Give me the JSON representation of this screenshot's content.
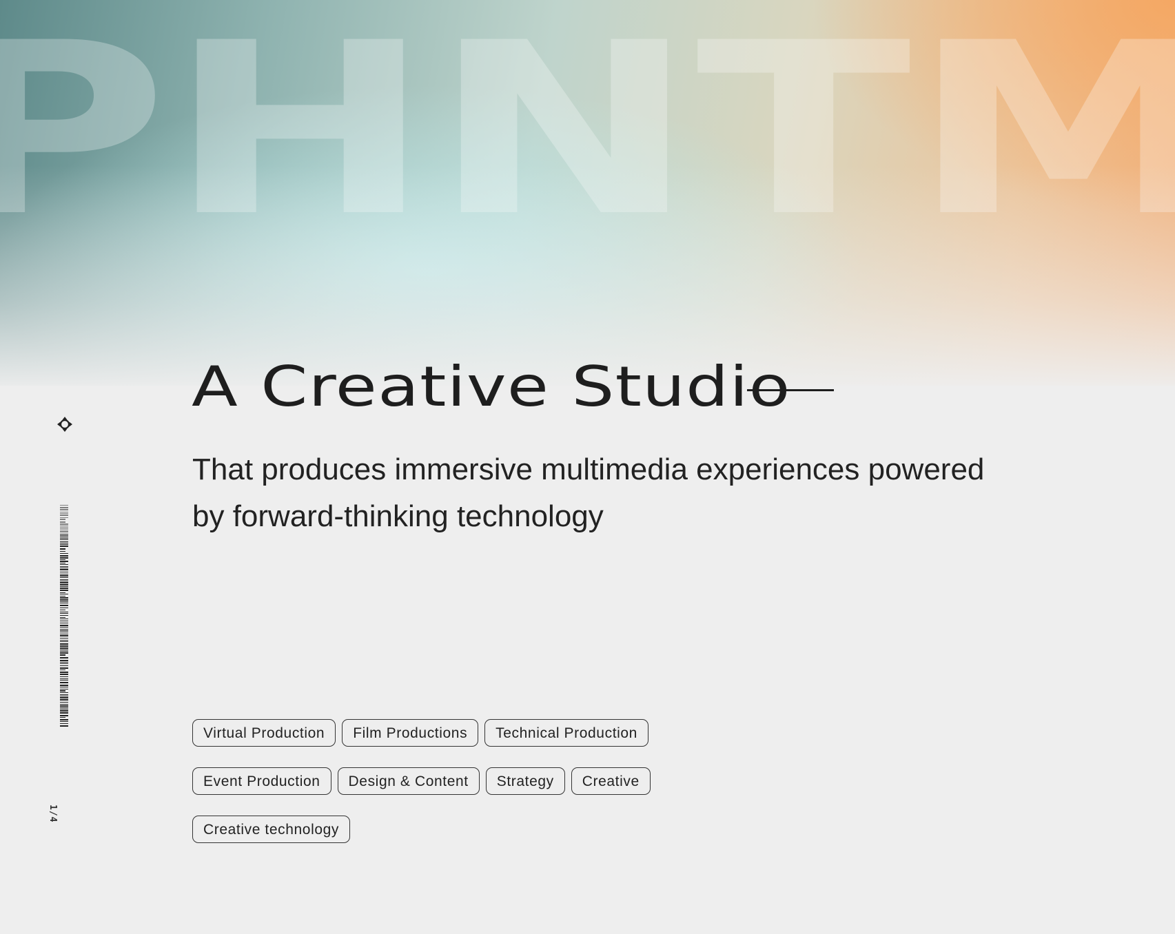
{
  "brand": {
    "watermark": "PHNTM"
  },
  "hero": {
    "title": "A Creative Studio",
    "subtitle": "That produces immersive multimedia experiences powered by forward-thinking technology"
  },
  "side_rail": {
    "icon": "move-arrows-icon",
    "page_indicator": "1/4"
  },
  "tags": [
    {
      "label": "Virtual Production"
    },
    {
      "label": "Film Productions"
    },
    {
      "label": "Technical Production"
    },
    {
      "label": "Event Production"
    },
    {
      "label": "Design & Content"
    },
    {
      "label": "Strategy"
    },
    {
      "label": "Creative"
    },
    {
      "label": "Creative technology"
    }
  ],
  "colors": {
    "background": "#eeeeee",
    "text": "#222222",
    "gradient_teal": "#5e8a8a",
    "gradient_mint": "#bee8e8",
    "gradient_orange": "#f2b07a"
  }
}
